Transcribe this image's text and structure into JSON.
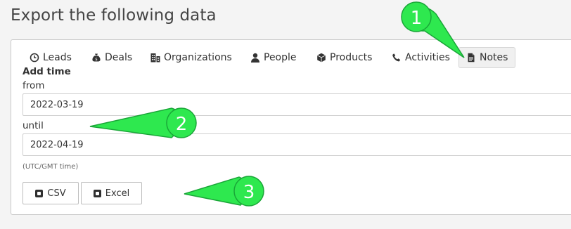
{
  "page": {
    "title": "Export the following data"
  },
  "tabs": [
    {
      "label": "Leads",
      "icon": "clock-icon"
    },
    {
      "label": "Deals",
      "icon": "money-bag-icon"
    },
    {
      "label": "Organizations",
      "icon": "building-icon"
    },
    {
      "label": "People",
      "icon": "person-icon"
    },
    {
      "label": "Products",
      "icon": "box-icon"
    },
    {
      "label": "Activities",
      "icon": "phone-icon"
    },
    {
      "label": "Notes",
      "icon": "document-icon",
      "active": true
    }
  ],
  "form": {
    "section_title": "Add time",
    "from_label": "from",
    "from_value": "2022-03-19",
    "until_label": "until",
    "until_value": "2022-04-19",
    "timezone_hint": "(UTC/GMT time)"
  },
  "buttons": {
    "csv": "CSV",
    "excel": "Excel"
  },
  "callouts": [
    "1",
    "2",
    "3"
  ],
  "colors": {
    "callout_fill": "#2ee84f",
    "callout_stroke": "#1aa638",
    "active_tab_bg": "#f0f0f0"
  }
}
